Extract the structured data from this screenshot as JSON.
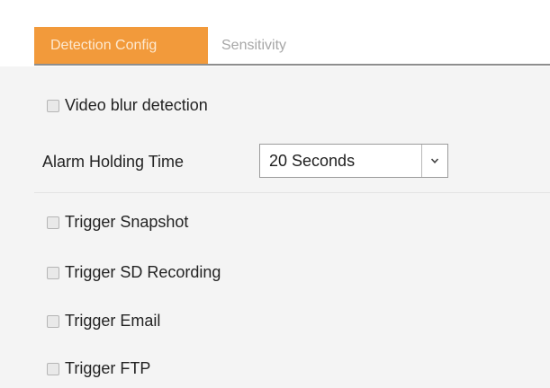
{
  "tabs": [
    {
      "label": "Detection Config",
      "active": true
    },
    {
      "label": "Sensitivity",
      "active": false
    }
  ],
  "video_blur": {
    "label": "Video blur detection",
    "checked": false
  },
  "alarm_holding": {
    "label": "Alarm Holding Time",
    "value": "20 Seconds"
  },
  "triggers": [
    {
      "label": "Trigger Snapshot",
      "checked": false
    },
    {
      "label": "Trigger SD Recording",
      "checked": false
    },
    {
      "label": "Trigger Email",
      "checked": false
    },
    {
      "label": "Trigger FTP",
      "checked": false
    }
  ],
  "colors": {
    "tab_active_bg": "#f29a3b",
    "tab_active_text": "#fde9d0",
    "tab_inactive_text": "#a7a7a7",
    "panel_bg": "#f4f4f4"
  },
  "icons": {
    "select_arrow": "chevron-down-icon",
    "checkbox": "checkbox-unchecked-icon"
  }
}
